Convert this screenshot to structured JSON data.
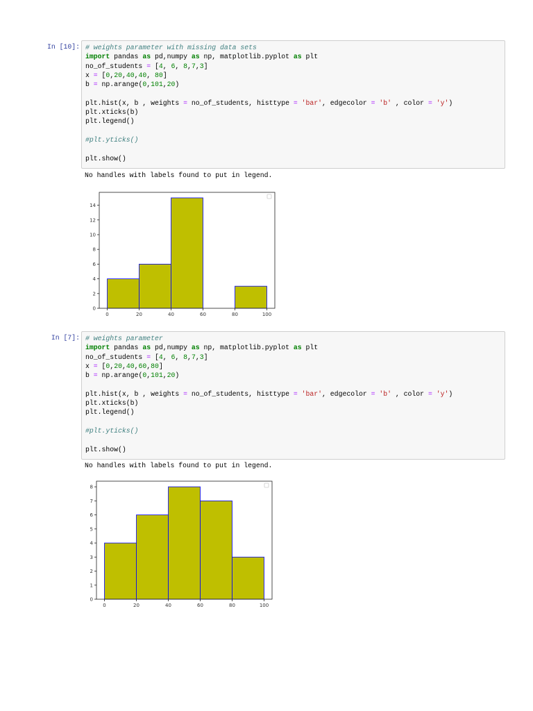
{
  "cells": [
    {
      "prompt": "In [10]:",
      "code_lines": [
        [
          {
            "t": "comment",
            "v": "# weights parameter with missing data sets"
          }
        ],
        [
          {
            "t": "kw",
            "v": "import"
          },
          {
            "t": "",
            "v": " pandas "
          },
          {
            "t": "kw",
            "v": "as"
          },
          {
            "t": "",
            "v": " pd,numpy "
          },
          {
            "t": "kw",
            "v": "as"
          },
          {
            "t": "",
            "v": " np, matplotlib.pyplot "
          },
          {
            "t": "kw",
            "v": "as"
          },
          {
            "t": "",
            "v": " plt"
          }
        ],
        [
          {
            "t": "",
            "v": "no_of_students "
          },
          {
            "t": "op",
            "v": "="
          },
          {
            "t": "",
            "v": " ["
          },
          {
            "t": "num",
            "v": "4"
          },
          {
            "t": "",
            "v": ", "
          },
          {
            "t": "num",
            "v": "6"
          },
          {
            "t": "",
            "v": ", "
          },
          {
            "t": "num",
            "v": "8"
          },
          {
            "t": "",
            "v": ","
          },
          {
            "t": "num",
            "v": "7"
          },
          {
            "t": "",
            "v": ","
          },
          {
            "t": "num",
            "v": "3"
          },
          {
            "t": "",
            "v": "]"
          }
        ],
        [
          {
            "t": "",
            "v": "x "
          },
          {
            "t": "op",
            "v": "="
          },
          {
            "t": "",
            "v": " ["
          },
          {
            "t": "num",
            "v": "0"
          },
          {
            "t": "",
            "v": ","
          },
          {
            "t": "num",
            "v": "20"
          },
          {
            "t": "",
            "v": ","
          },
          {
            "t": "num",
            "v": "40"
          },
          {
            "t": "",
            "v": ","
          },
          {
            "t": "num",
            "v": "40"
          },
          {
            "t": "",
            "v": ", "
          },
          {
            "t": "num",
            "v": "80"
          },
          {
            "t": "",
            "v": "]"
          }
        ],
        [
          {
            "t": "",
            "v": "b "
          },
          {
            "t": "op",
            "v": "="
          },
          {
            "t": "",
            "v": " np.arange("
          },
          {
            "t": "num",
            "v": "0"
          },
          {
            "t": "",
            "v": ","
          },
          {
            "t": "num",
            "v": "101"
          },
          {
            "t": "",
            "v": ","
          },
          {
            "t": "num",
            "v": "20"
          },
          {
            "t": "",
            "v": ")"
          }
        ],
        [],
        [
          {
            "t": "",
            "v": "plt.hist(x, b , weights "
          },
          {
            "t": "op",
            "v": "="
          },
          {
            "t": "",
            "v": " no_of_students, histtype "
          },
          {
            "t": "op",
            "v": "="
          },
          {
            "t": "",
            "v": " "
          },
          {
            "t": "str",
            "v": "'bar'"
          },
          {
            "t": "",
            "v": ", edgecolor "
          },
          {
            "t": "op",
            "v": "="
          },
          {
            "t": "",
            "v": " "
          },
          {
            "t": "str",
            "v": "'b'"
          },
          {
            "t": "",
            "v": " , color "
          },
          {
            "t": "op",
            "v": "="
          },
          {
            "t": "",
            "v": " "
          },
          {
            "t": "str",
            "v": "'y'"
          },
          {
            "t": "",
            "v": ")"
          }
        ],
        [
          {
            "t": "",
            "v": "plt.xticks(b)"
          }
        ],
        [
          {
            "t": "",
            "v": "plt.legend()"
          }
        ],
        [],
        [
          {
            "t": "comment",
            "v": "#plt.yticks()"
          }
        ],
        [],
        [
          {
            "t": "",
            "v": "plt.show()"
          }
        ]
      ],
      "output": "No handles with labels found to put in legend."
    },
    {
      "prompt": "In [7]:",
      "code_lines": [
        [
          {
            "t": "comment",
            "v": "# weights parameter"
          }
        ],
        [
          {
            "t": "kw",
            "v": "import"
          },
          {
            "t": "",
            "v": " pandas "
          },
          {
            "t": "kw",
            "v": "as"
          },
          {
            "t": "",
            "v": " pd,numpy "
          },
          {
            "t": "kw",
            "v": "as"
          },
          {
            "t": "",
            "v": " np, matplotlib.pyplot "
          },
          {
            "t": "kw",
            "v": "as"
          },
          {
            "t": "",
            "v": " plt"
          }
        ],
        [
          {
            "t": "",
            "v": "no_of_students "
          },
          {
            "t": "op",
            "v": "="
          },
          {
            "t": "",
            "v": " ["
          },
          {
            "t": "num",
            "v": "4"
          },
          {
            "t": "",
            "v": ", "
          },
          {
            "t": "num",
            "v": "6"
          },
          {
            "t": "",
            "v": ", "
          },
          {
            "t": "num",
            "v": "8"
          },
          {
            "t": "",
            "v": ","
          },
          {
            "t": "num",
            "v": "7"
          },
          {
            "t": "",
            "v": ","
          },
          {
            "t": "num",
            "v": "3"
          },
          {
            "t": "",
            "v": "]"
          }
        ],
        [
          {
            "t": "",
            "v": "x "
          },
          {
            "t": "op",
            "v": "="
          },
          {
            "t": "",
            "v": " ["
          },
          {
            "t": "num",
            "v": "0"
          },
          {
            "t": "",
            "v": ","
          },
          {
            "t": "num",
            "v": "20"
          },
          {
            "t": "",
            "v": ","
          },
          {
            "t": "num",
            "v": "40"
          },
          {
            "t": "",
            "v": ","
          },
          {
            "t": "num",
            "v": "60"
          },
          {
            "t": "",
            "v": ","
          },
          {
            "t": "num",
            "v": "80"
          },
          {
            "t": "",
            "v": "]"
          }
        ],
        [
          {
            "t": "",
            "v": "b "
          },
          {
            "t": "op",
            "v": "="
          },
          {
            "t": "",
            "v": " np.arange("
          },
          {
            "t": "num",
            "v": "0"
          },
          {
            "t": "",
            "v": ","
          },
          {
            "t": "num",
            "v": "101"
          },
          {
            "t": "",
            "v": ","
          },
          {
            "t": "num",
            "v": "20"
          },
          {
            "t": "",
            "v": ")"
          }
        ],
        [],
        [
          {
            "t": "",
            "v": "plt.hist(x, b , weights "
          },
          {
            "t": "op",
            "v": "="
          },
          {
            "t": "",
            "v": " no_of_students, histtype "
          },
          {
            "t": "op",
            "v": "="
          },
          {
            "t": "",
            "v": " "
          },
          {
            "t": "str",
            "v": "'bar'"
          },
          {
            "t": "",
            "v": ", edgecolor "
          },
          {
            "t": "op",
            "v": "="
          },
          {
            "t": "",
            "v": " "
          },
          {
            "t": "str",
            "v": "'b'"
          },
          {
            "t": "",
            "v": " , color "
          },
          {
            "t": "op",
            "v": "="
          },
          {
            "t": "",
            "v": " "
          },
          {
            "t": "str",
            "v": "'y'"
          },
          {
            "t": "",
            "v": ")"
          }
        ],
        [
          {
            "t": "",
            "v": "plt.xticks(b)"
          }
        ],
        [
          {
            "t": "",
            "v": "plt.legend()"
          }
        ],
        [],
        [
          {
            "t": "comment",
            "v": "#plt.yticks()"
          }
        ],
        [],
        [
          {
            "t": "",
            "v": "plt.show()"
          }
        ]
      ],
      "output": "No handles with labels found to put in legend."
    }
  ],
  "chart_data": [
    {
      "type": "bar",
      "bins": [
        0,
        20,
        40,
        60,
        80,
        100
      ],
      "values": [
        4,
        6,
        15,
        0,
        3
      ],
      "xticks": [
        "0",
        "20",
        "40",
        "60",
        "80",
        "100"
      ],
      "yticks": [
        "0",
        "2",
        "4",
        "6",
        "8",
        "10",
        "12",
        "14"
      ],
      "xlim": [
        -5,
        105
      ],
      "ylim": [
        0,
        15.75
      ],
      "fill_color": "#bfbf00",
      "edge_color": "#0000ff",
      "legend": "top-right (empty)"
    },
    {
      "type": "bar",
      "bins": [
        0,
        20,
        40,
        60,
        80,
        100
      ],
      "values": [
        4,
        6,
        8,
        7,
        3
      ],
      "xticks": [
        "0",
        "20",
        "40",
        "60",
        "80",
        "100"
      ],
      "yticks": [
        "0",
        "1",
        "2",
        "3",
        "4",
        "5",
        "6",
        "7",
        "8"
      ],
      "xlim": [
        -5,
        105
      ],
      "ylim": [
        0,
        8.4
      ],
      "fill_color": "#bfbf00",
      "edge_color": "#0000ff",
      "legend": "top-right (empty)"
    }
  ]
}
